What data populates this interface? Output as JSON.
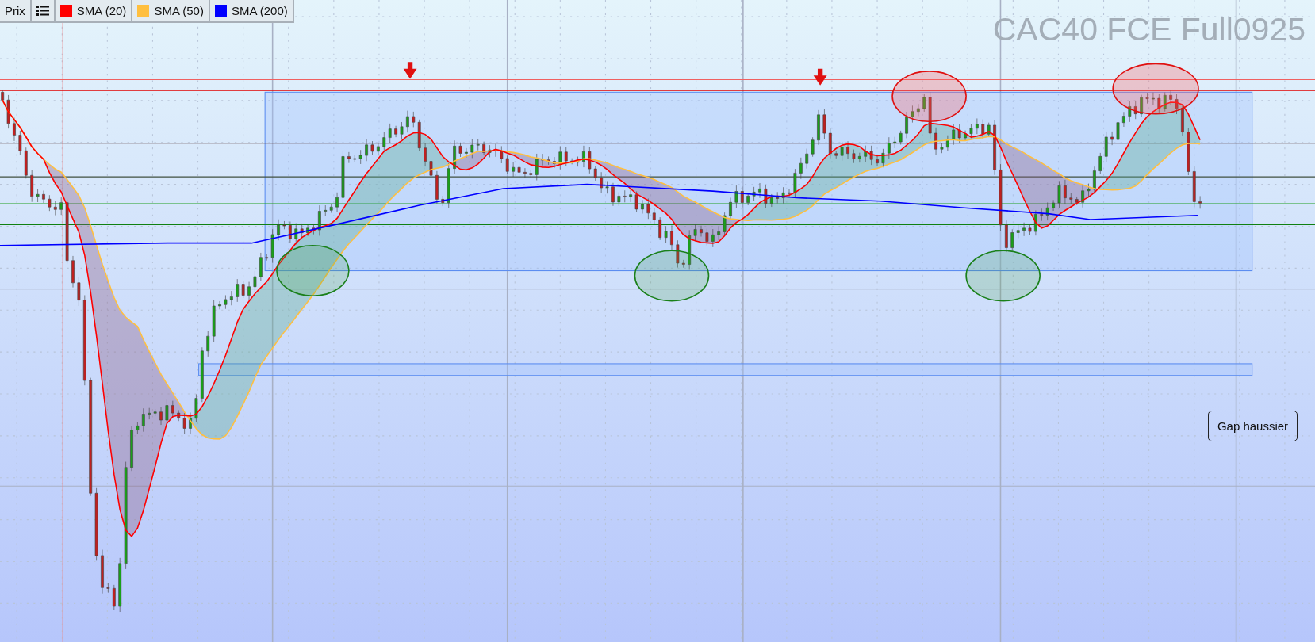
{
  "legend": [
    {
      "kind": "label",
      "label": "Prix"
    },
    {
      "kind": "menu"
    },
    {
      "kind": "series",
      "label": "SMA (20)",
      "color": "#ff0000"
    },
    {
      "kind": "series",
      "label": "SMA (50)",
      "color": "#ffbf3f"
    },
    {
      "kind": "series",
      "label": "SMA (200)",
      "color": "#0000ff"
    }
  ],
  "chart_title": "CAC40 FCE Full0925",
  "annotation": "Gap haussier"
}
